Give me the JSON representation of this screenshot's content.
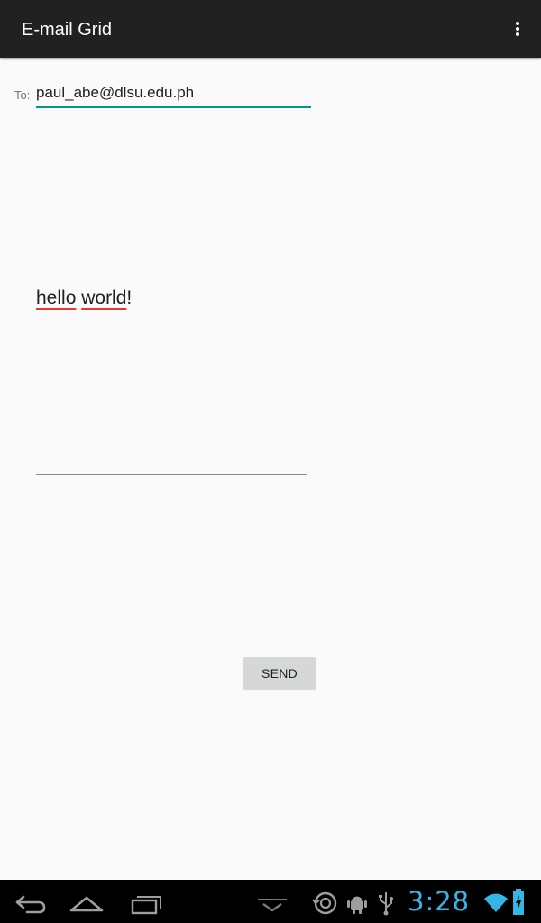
{
  "app_bar": {
    "title": "E-mail Grid",
    "overflow_icon": "more-vert-icon"
  },
  "form": {
    "to_label": "To:",
    "to_value": "paul_abe@dlsu.edu.ph",
    "message_words": [
      "hello",
      " ",
      "world",
      "!"
    ],
    "send_label": "SEND"
  },
  "system_bar": {
    "clock": "3:28",
    "icons": [
      "back-icon",
      "home-icon",
      "recents-icon",
      "menu-chevron-icon",
      "sync-icon",
      "android-debug-icon",
      "usb-icon",
      "wifi-icon",
      "battery-icon"
    ]
  },
  "colors": {
    "app_bar": "#212121",
    "background": "#fafafa",
    "accent": "#009688",
    "button": "#d6d7d7",
    "spell_underline": "#e53935",
    "clock": "#33b5e5"
  }
}
